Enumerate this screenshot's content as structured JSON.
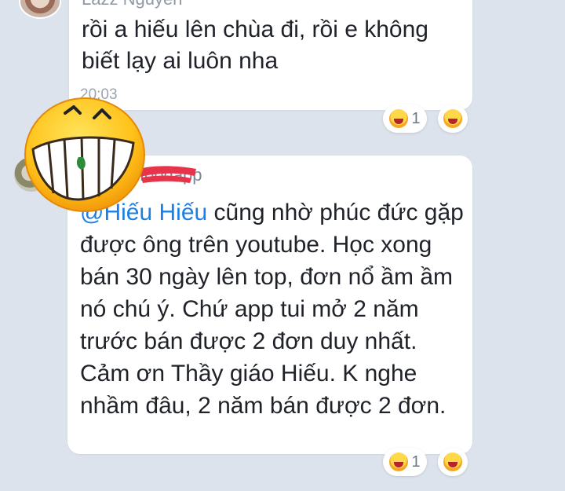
{
  "messages": [
    {
      "sender": "Lazz Nguyen",
      "text": "rồi a hiếu lên chùa đi, rồi e không biết lạy ai luôn nha",
      "time": "20:03",
      "reaction_count": "1"
    },
    {
      "sender_visible": "foodapp",
      "mention": "@Hiếu Hiếu",
      "text": " cũng nhờ phúc đức gặp được ông trên youtube. Học xong bán 30 ngày lên top, đơn nổ ầm ầm nó chú ý. Chứ app tui mở 2 năm trước bán được 2 đơn duy nhất. Cảm ơn Thầy giáo Hiếu. K nghe nhầm đâu, 2 năm bán được 2 đơn.",
      "reaction_count": "1"
    }
  ],
  "icons": {
    "reaction": "laughing-face-icon",
    "overlay": "grinning-face-sticker"
  },
  "colors": {
    "background": "#dde3ec",
    "bubble": "#ffffff",
    "mention": "#1a7fe6",
    "redaction": "#e8344a"
  }
}
